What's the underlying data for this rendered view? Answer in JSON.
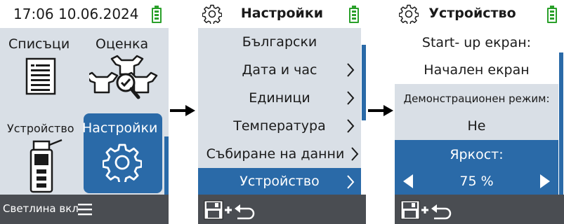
{
  "screen1": {
    "status_time": "17:06 10.06.2024",
    "tiles": {
      "lists": "Списъци",
      "evaluation": "Оценка",
      "device": "Устройство",
      "settings": "Настройки"
    },
    "footer_text": "Светлина вкл"
  },
  "screen2": {
    "title": "Настройки",
    "items": [
      {
        "label": "Български"
      },
      {
        "label": "Дата и час"
      },
      {
        "label": "Единици"
      },
      {
        "label": "Температура"
      },
      {
        "label": "Събиране на данни"
      },
      {
        "label": "Устройство"
      }
    ],
    "selected_item": "Устройство"
  },
  "screen3": {
    "title": "Устройство",
    "startup_label": "Start- up екран:",
    "startup_value": "Начален екран",
    "demo_label": "Демонстрационен режим:",
    "demo_value": "Не",
    "brightness_label": "Яркост:",
    "brightness_value": "75 %",
    "brightness_percent": 75
  },
  "colors": {
    "accent": "#2a6aa8",
    "panel_bg": "#d9dfe6",
    "footer_bg": "#4a4d52",
    "battery": "#2aa02a"
  }
}
